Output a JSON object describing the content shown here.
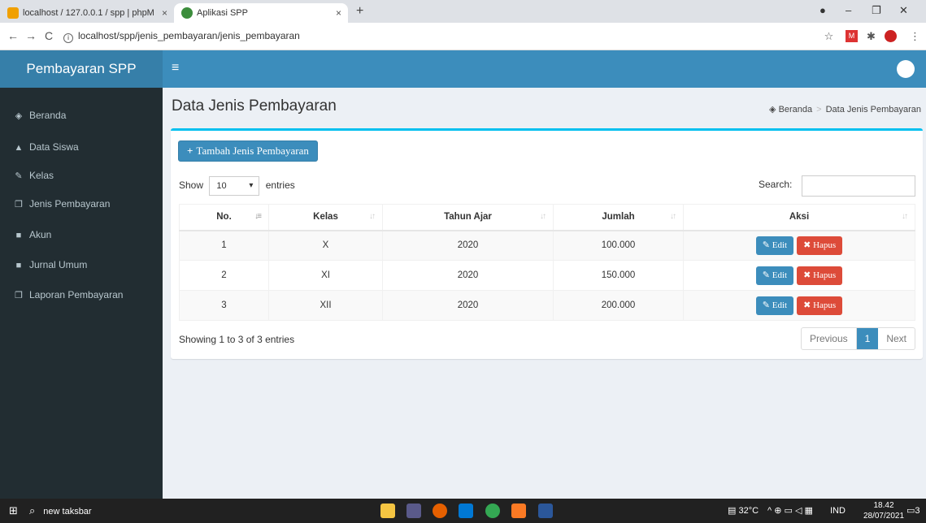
{
  "browser": {
    "tabs": [
      {
        "title": "localhost / 127.0.0.1 / spp | phpM",
        "close": "×"
      },
      {
        "title": "Aplikasi SPP",
        "close": "×"
      }
    ],
    "new_tab": "+",
    "url": "localhost/spp/jenis_pembayaran/jenis_pembayaran",
    "info_glyph": "i",
    "back": "←",
    "forward": "→",
    "reload": "C"
  },
  "app": {
    "brand": "Pembayaran SPP",
    "menu_toggle": "≡"
  },
  "sidebar": {
    "items": [
      {
        "label": "Beranda",
        "icon": "dashboard-icon"
      },
      {
        "label": "Data Siswa",
        "icon": "user-icon"
      },
      {
        "label": "Kelas",
        "icon": "edit-icon"
      },
      {
        "label": "Jenis Pembayaran",
        "icon": "copy-icon"
      },
      {
        "label": "Akun",
        "icon": "book-icon"
      },
      {
        "label": "Jurnal Umum",
        "icon": "book-icon"
      },
      {
        "label": "Laporan Pembayaran",
        "icon": "copy-icon"
      }
    ]
  },
  "page": {
    "title": "Data Jenis Pembayaran",
    "breadcrumb": [
      "Beranda",
      "Data Jenis Pembayaran"
    ]
  },
  "toolbar": {
    "add_label": "Tambah Jenis Pembayaran"
  },
  "table_controls": {
    "show_label": "Show",
    "entries_value": "10",
    "entries_label": "entries",
    "search_label": "Search:",
    "search_value": ""
  },
  "table": {
    "columns": [
      "No.",
      "Kelas",
      "Tahun Ajar",
      "Jumlah",
      "Aksi"
    ],
    "rows": [
      {
        "no": "1",
        "kelas": "X",
        "tahun": "2020",
        "jumlah": "100.000"
      },
      {
        "no": "2",
        "kelas": "XI",
        "tahun": "2020",
        "jumlah": "150.000"
      },
      {
        "no": "3",
        "kelas": "XII",
        "tahun": "2020",
        "jumlah": "200.000"
      }
    ],
    "edit_label": "Edit",
    "delete_label": "Hapus"
  },
  "footer": {
    "info": "Showing 1 to 3 of 3 entries",
    "prev": "Previous",
    "page": "1",
    "next": "Next"
  },
  "taskbar": {
    "search_text": "new taksbar",
    "weather": "32°C",
    "lang": "IND",
    "time": "18.42",
    "date": "28/07/2021",
    "notif_count": "3"
  },
  "colors": {
    "header": "#3c8dbc",
    "sidebar": "#222d32",
    "danger": "#dd4b39"
  }
}
